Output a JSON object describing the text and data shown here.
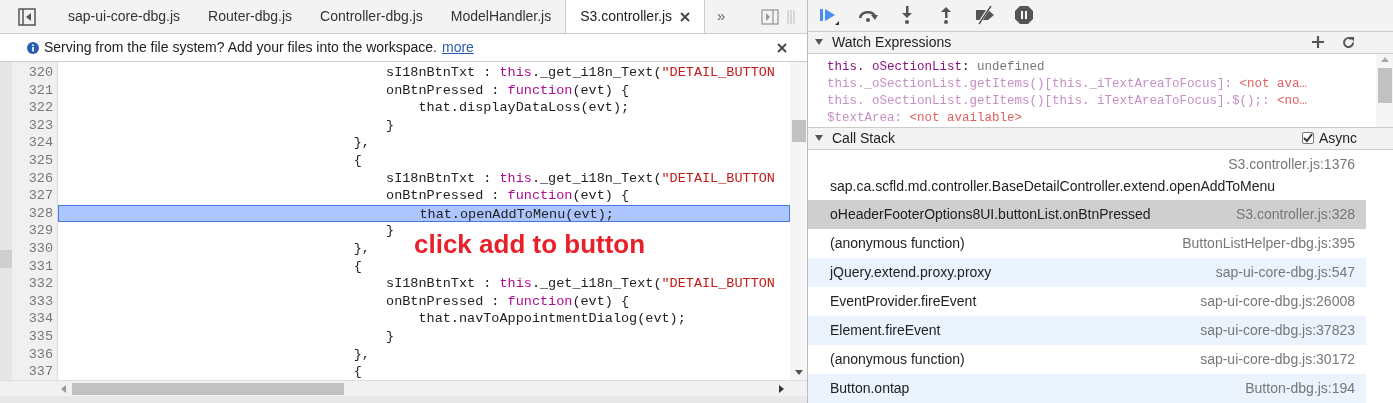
{
  "tabs": [
    {
      "label": "sap-ui-core-dbg.js",
      "selected": false
    },
    {
      "label": "Router-dbg.js",
      "selected": false
    },
    {
      "label": "Controller-dbg.js",
      "selected": false
    },
    {
      "label": "ModelHandler.js",
      "selected": false
    },
    {
      "label": "S3.controller.js",
      "selected": true
    }
  ],
  "more_tabs": "»",
  "infobar": {
    "message": "Serving from the file system? Add your files into the workspace.",
    "link": "more"
  },
  "code_lines": [
    {
      "number": "320",
      "selected": false,
      "segments": [
        {
          "kind": "plain",
          "text": "                                        sI18nBtnTxt : "
        },
        {
          "kind": "keyword",
          "text": "this"
        },
        {
          "kind": "plain",
          "text": "._get_i18n_Text("
        },
        {
          "kind": "string",
          "text": "\"DETAIL_BUTTON"
        }
      ]
    },
    {
      "number": "321",
      "selected": false,
      "segments": [
        {
          "kind": "plain",
          "text": "                                        onBtnPressed : "
        },
        {
          "kind": "keyword",
          "text": "function"
        },
        {
          "kind": "plain",
          "text": "(evt) {"
        }
      ]
    },
    {
      "number": "322",
      "selected": false,
      "segments": [
        {
          "kind": "plain",
          "text": "                                            that.displayDataLoss(evt);"
        }
      ]
    },
    {
      "number": "323",
      "selected": false,
      "segments": [
        {
          "kind": "plain",
          "text": "                                        }"
        }
      ]
    },
    {
      "number": "324",
      "selected": false,
      "segments": [
        {
          "kind": "plain",
          "text": "                                    },"
        }
      ]
    },
    {
      "number": "325",
      "selected": false,
      "segments": [
        {
          "kind": "plain",
          "text": "                                    {"
        }
      ]
    },
    {
      "number": "326",
      "selected": false,
      "segments": [
        {
          "kind": "plain",
          "text": "                                        sI18nBtnTxt : "
        },
        {
          "kind": "keyword",
          "text": "this"
        },
        {
          "kind": "plain",
          "text": "._get_i18n_Text("
        },
        {
          "kind": "string",
          "text": "\"DETAIL_BUTTON"
        }
      ]
    },
    {
      "number": "327",
      "selected": false,
      "segments": [
        {
          "kind": "plain",
          "text": "                                        onBtnPressed : "
        },
        {
          "kind": "keyword",
          "text": "function"
        },
        {
          "kind": "plain",
          "text": "(evt) {"
        }
      ]
    },
    {
      "number": "328",
      "selected": true,
      "segments": [
        {
          "kind": "plain",
          "text": "                                            that.openAddToMenu(evt);"
        }
      ]
    },
    {
      "number": "329",
      "selected": false,
      "segments": [
        {
          "kind": "plain",
          "text": "                                        }"
        }
      ]
    },
    {
      "number": "330",
      "selected": false,
      "segments": [
        {
          "kind": "plain",
          "text": "                                    },"
        }
      ]
    },
    {
      "number": "331",
      "selected": false,
      "segments": [
        {
          "kind": "plain",
          "text": "                                    {"
        }
      ]
    },
    {
      "number": "332",
      "selected": false,
      "segments": [
        {
          "kind": "plain",
          "text": "                                        sI18nBtnTxt : "
        },
        {
          "kind": "keyword",
          "text": "this"
        },
        {
          "kind": "plain",
          "text": "._get_i18n_Text("
        },
        {
          "kind": "string",
          "text": "\"DETAIL_BUTTON"
        }
      ]
    },
    {
      "number": "333",
      "selected": false,
      "segments": [
        {
          "kind": "plain",
          "text": "                                        onBtnPressed : "
        },
        {
          "kind": "keyword",
          "text": "function"
        },
        {
          "kind": "plain",
          "text": "(evt) {"
        }
      ]
    },
    {
      "number": "334",
      "selected": false,
      "segments": [
        {
          "kind": "plain",
          "text": "                                            that.navToAppointmentDialog(evt);"
        }
      ]
    },
    {
      "number": "335",
      "selected": false,
      "segments": [
        {
          "kind": "plain",
          "text": "                                        }"
        }
      ]
    },
    {
      "number": "336",
      "selected": false,
      "segments": [
        {
          "kind": "plain",
          "text": "                                    },"
        }
      ]
    },
    {
      "number": "337",
      "selected": false,
      "segments": [
        {
          "kind": "plain",
          "text": "                                    {"
        }
      ]
    }
  ],
  "annotation": "click add to button",
  "watch": {
    "title": "Watch Expressions",
    "expanded": true,
    "items": [
      {
        "name": "this. oSectionList",
        "separator": ":",
        "value": "undefined",
        "available": true
      },
      {
        "name": "this._oSectionList.getItems()[this._iTextAreaToFocus]",
        "separator": ":",
        "value": "<not ava…",
        "available": false
      },
      {
        "name": "this. oSectionList.getItems()[this. iTextAreaToFocus].$();",
        "separator": ":",
        "value": "<no…",
        "available": false
      },
      {
        "name": "$textArea",
        "separator": ":",
        "value": "<not available>",
        "available": false
      }
    ]
  },
  "call_stack": {
    "title": "Call Stack",
    "expanded": true,
    "async": {
      "label": "Async",
      "checked": true
    },
    "frames": [
      {
        "name": "sap.ca.scfld.md.controller.BaseDetailController.extend.openAddToMenu",
        "location": "S3.controller.js:1376",
        "selected": false,
        "shaded": false,
        "wrapped": true
      },
      {
        "name": "oHeaderFooterOptions8UI.buttonList.onBtnPressed",
        "location": "S3.controller.js:328",
        "selected": true,
        "shaded": false,
        "wrapped": false
      },
      {
        "name": "(anonymous function)",
        "location": "ButtonListHelper-dbg.js:395",
        "selected": false,
        "shaded": false,
        "wrapped": false
      },
      {
        "name": "jQuery.extend.proxy.proxy",
        "location": "sap-ui-core-dbg.js:547",
        "selected": false,
        "shaded": true,
        "wrapped": false
      },
      {
        "name": "EventProvider.fireEvent",
        "location": "sap-ui-core-dbg.js:26008",
        "selected": false,
        "shaded": false,
        "wrapped": false
      },
      {
        "name": "Element.fireEvent",
        "location": "sap-ui-core-dbg.js:37823",
        "selected": false,
        "shaded": true,
        "wrapped": false
      },
      {
        "name": "(anonymous function)",
        "location": "sap-ui-core-dbg.js:30172",
        "selected": false,
        "shaded": false,
        "wrapped": false
      },
      {
        "name": "Button.ontap",
        "location": "Button-dbg.js:194",
        "selected": false,
        "shaded": true,
        "wrapped": false
      }
    ]
  }
}
